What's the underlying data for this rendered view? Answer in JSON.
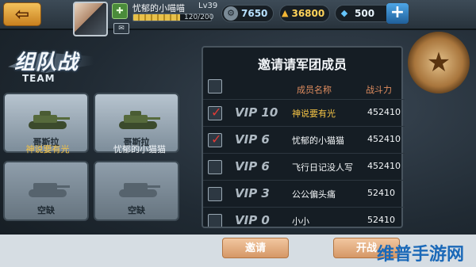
{
  "header": {
    "back_icon": "back-arrow-icon",
    "player_name": "忧郁的小喵喵",
    "level": "Lv39",
    "exp_text": "120/200",
    "exp_progress": 0.6,
    "mail_icon": "mail-icon",
    "resources": [
      {
        "icon": "gear-coin-icon",
        "value": "7650"
      },
      {
        "icon": "gold-bars-icon",
        "value": "36800"
      },
      {
        "icon": "diamond-icon",
        "value": "500"
      }
    ],
    "plus_icon": "plus-icon"
  },
  "left": {
    "title": "组队战",
    "subtitle": "TEAM",
    "slots": [
      {
        "card_name": "哥斯拉",
        "player": "神说要有光",
        "player_color": "#f6c445",
        "empty": false
      },
      {
        "card_name": "哥斯拉",
        "player": "忧郁的小猫猫",
        "player_color": "#f1f5f8",
        "empty": false
      },
      {
        "card_name": "空缺",
        "player": "",
        "empty": true
      },
      {
        "card_name": "空缺",
        "player": "",
        "empty": true
      }
    ]
  },
  "panel": {
    "title": "邀请请军团成员",
    "col_name": "成员名称",
    "col_power": "战斗力",
    "rows": [
      {
        "vip": "VIP 10",
        "name": "神说要有光",
        "power": "452410",
        "checked": true,
        "name_color": "#f6c445"
      },
      {
        "vip": "VIP 6",
        "name": "忧郁的小猫猫",
        "power": "452410",
        "checked": true,
        "name_color": "#f3f6f8"
      },
      {
        "vip": "VIP 6",
        "name": "飞行日记没人写",
        "power": "452410",
        "checked": false,
        "name_color": "#f3f6f8"
      },
      {
        "vip": "VIP 3",
        "name": "公公偏头痛",
        "power": "52410",
        "checked": false,
        "name_color": "#f3f6f8"
      },
      {
        "vip": "VIP 0",
        "name": "小小",
        "power": "52410",
        "checked": false,
        "name_color": "#f3f6f8"
      }
    ]
  },
  "buttons": {
    "invite": "邀请",
    "start": "开战"
  },
  "watermark": "维普手游网",
  "colors": {
    "accent": "#f6c445",
    "header_text": "#e08d5f",
    "check": "#e23b36"
  }
}
